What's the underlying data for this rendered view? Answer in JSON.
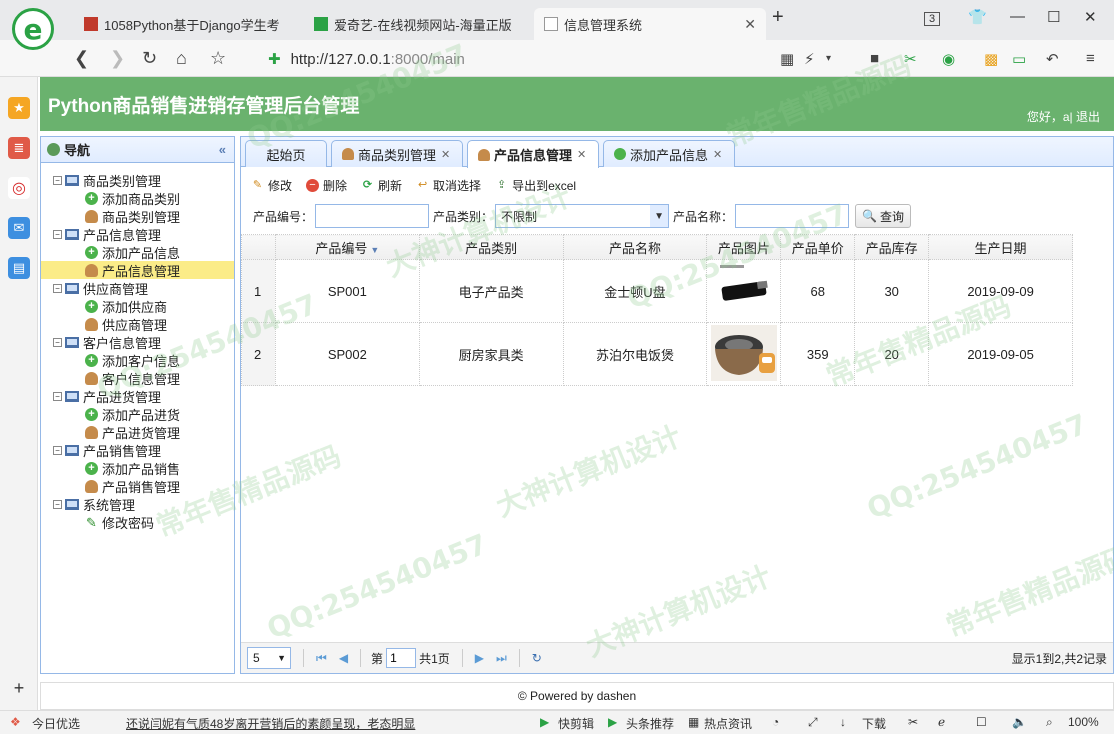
{
  "browser": {
    "tabs": [
      {
        "title": "1058Python基于Django学生考"
      },
      {
        "title": "爱奇艺-在线视频网站-海量正版"
      },
      {
        "title": "信息管理系统"
      }
    ],
    "tab_count": "3",
    "url_host": "http://127.0.0.1",
    "url_rest": ":8000/main",
    "logo_letter": "e"
  },
  "app": {
    "title": "Python商品销售进销存管理后台管理",
    "greeting": "您好，a| 退出"
  },
  "nav": {
    "title": "导航",
    "groups": [
      {
        "label": "商品类别管理",
        "items": [
          "添加商品类别",
          "商品类别管理"
        ]
      },
      {
        "label": "产品信息管理",
        "items": [
          "添加产品信息",
          "产品信息管理"
        ]
      },
      {
        "label": "供应商管理",
        "items": [
          "添加供应商",
          "供应商管理"
        ]
      },
      {
        "label": "客户信息管理",
        "items": [
          "添加客户信息",
          "客户信息管理"
        ]
      },
      {
        "label": "产品进货管理",
        "items": [
          "添加产品进货",
          "产品进货管理"
        ]
      },
      {
        "label": "产品销售管理",
        "items": [
          "添加产品销售",
          "产品销售管理"
        ]
      },
      {
        "label": "系统管理",
        "items": [
          "修改密码"
        ]
      }
    ]
  },
  "tabs": [
    "起始页",
    "商品类别管理",
    "产品信息管理",
    "添加产品信息"
  ],
  "toolbar": {
    "edit": "修改",
    "delete": "删除",
    "refresh": "刷新",
    "unselect": "取消选择",
    "export": "导出到excel"
  },
  "search": {
    "code_label": "产品编号：",
    "type_label": "产品类别：",
    "type_value": "不限制",
    "name_label": "产品名称：",
    "query_label": "查询"
  },
  "grid": {
    "columns": [
      "产品编号",
      "产品类别",
      "产品名称",
      "产品图片",
      "产品单价",
      "产品库存",
      "生产日期"
    ],
    "rows": [
      {
        "n": "1",
        "code": "SP001",
        "type": "电子产品类",
        "name": "金士顿U盘",
        "price": "68",
        "stock": "30",
        "date": "2019-09-09"
      },
      {
        "n": "2",
        "code": "SP002",
        "type": "厨房家具类",
        "name": "苏泊尔电饭煲",
        "price": "359",
        "stock": "20",
        "date": "2019-09-05"
      }
    ]
  },
  "pager": {
    "page_size": "5",
    "page_prefix": "第",
    "page_value": "1",
    "page_suffix": "共1页",
    "info": "显示1到2,共2记录"
  },
  "footer": "© Powered by dashen",
  "statusbar": {
    "today": "今日优选",
    "news": "还说闫妮有气质48岁离开营销后的素颜呈现，老态明显",
    "kuaijianji": "快剪辑",
    "toutiao": "头条推荐",
    "hot": "热点资讯",
    "download": "下载",
    "zoom": "100%"
  },
  "watermarks": [
    "QQ:254540457",
    "大神计算机设计",
    "常年售精品源码"
  ]
}
